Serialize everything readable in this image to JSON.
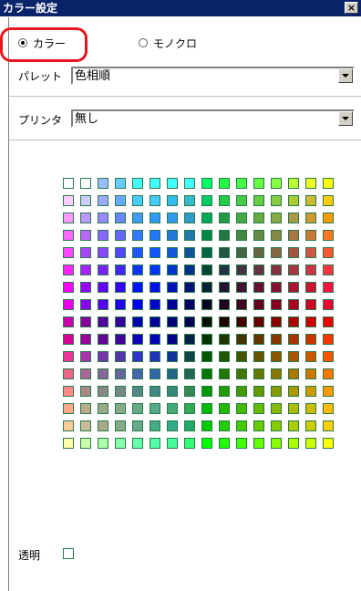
{
  "window": {
    "title": "カラー設定",
    "close_label": "×"
  },
  "mode": {
    "options": [
      "カラー",
      "モノクロ"
    ],
    "selected": "カラー"
  },
  "palette": {
    "label": "パレット",
    "value": "色相順"
  },
  "printer": {
    "label": "プリンタ",
    "value": "無し"
  },
  "transparent": {
    "label": "透明"
  },
  "colors": {
    "title_bar": "#0a246a",
    "highlight": "#e8141e",
    "swatch_border": "#2a7a4a"
  },
  "swatches": [
    [
      "#ffffff",
      "#ffffff",
      "#99bbff",
      "#66ccff",
      "#44ffff",
      "#44ffff",
      "#44ffff",
      "#44ffff",
      "#00ff66",
      "#22ff44",
      "#44ff44",
      "#66ff44",
      "#88ff44",
      "#bbff33",
      "#eeff22",
      "#ffff00"
    ],
    [
      "#ffccff",
      "#ccccff",
      "#99aaff",
      "#66aaff",
      "#44ccff",
      "#44ccff",
      "#33bbee",
      "#33bbcc",
      "#00cc66",
      "#22cc44",
      "#44cc44",
      "#66cc44",
      "#88cc44",
      "#aacc33",
      "#ccbb33",
      "#ffcc00"
    ],
    [
      "#ff99ff",
      "#bb99ff",
      "#9988ff",
      "#6688ff",
      "#4499ff",
      "#3399ff",
      "#3399ee",
      "#3399cc",
      "#00aa55",
      "#229944",
      "#44aa44",
      "#66aa44",
      "#88aa44",
      "#aa9944",
      "#cc9933",
      "#ff9900"
    ],
    [
      "#ff66ff",
      "#bb66ff",
      "#8866ff",
      "#6666ff",
      "#3377ff",
      "#2277ff",
      "#2277dd",
      "#2277aa",
      "#008844",
      "#227744",
      "#448844",
      "#668844",
      "#888844",
      "#aa7744",
      "#cc7733",
      "#ff7722"
    ],
    [
      "#ff44ff",
      "#aa44ff",
      "#8844ff",
      "#5544ff",
      "#2255ff",
      "#1155ff",
      "#1155dd",
      "#115599",
      "#006644",
      "#225544",
      "#446644",
      "#666644",
      "#886644",
      "#aa5544",
      "#cc5544",
      "#ff5533"
    ],
    [
      "#ff22ff",
      "#aa22ff",
      "#7722ff",
      "#4422ff",
      "#1133ff",
      "#0033ff",
      "#0033cc",
      "#003388",
      "#004433",
      "#223344",
      "#443344",
      "#663344",
      "#883344",
      "#aa3344",
      "#cc3344",
      "#ff3344"
    ],
    [
      "#ff00ff",
      "#9900ff",
      "#6600ff",
      "#3300ff",
      "#0011ff",
      "#0011ee",
      "#0011bb",
      "#001177",
      "#002233",
      "#221133",
      "#441133",
      "#661133",
      "#881133",
      "#aa1133",
      "#cc1133",
      "#ff1144"
    ],
    [
      "#ee00ee",
      "#8800ee",
      "#5500ee",
      "#2200ee",
      "#0000ee",
      "#0000cc",
      "#000099",
      "#000066",
      "#000022",
      "#220022",
      "#440022",
      "#660022",
      "#880022",
      "#aa0022",
      "#cc0022",
      "#ee0033"
    ],
    [
      "#cc00aa",
      "#880099",
      "#550099",
      "#330099",
      "#0000aa",
      "#000099",
      "#000077",
      "#000055",
      "#001100",
      "#220000",
      "#440000",
      "#660000",
      "#880000",
      "#aa0000",
      "#cc0000",
      "#ee0000"
    ],
    [
      "#dd0099",
      "#990099",
      "#660099",
      "#440099",
      "#1100bb",
      "#0000bb",
      "#000088",
      "#002244",
      "#003300",
      "#223300",
      "#443300",
      "#663300",
      "#883300",
      "#aa3300",
      "#cc3300",
      "#ff3300"
    ],
    [
      "#ee3399",
      "#aa33aa",
      "#7733aa",
      "#5533aa",
      "#3333cc",
      "#2233bb",
      "#113399",
      "#114444",
      "#005500",
      "#225500",
      "#445500",
      "#665500",
      "#885500",
      "#aa5500",
      "#cc5500",
      "#ff5500"
    ],
    [
      "#ee6688",
      "#aa6699",
      "#886699",
      "#666699",
      "#4466aa",
      "#3366aa",
      "#226688",
      "#226655",
      "#007700",
      "#227700",
      "#447700",
      "#667700",
      "#887700",
      "#aa7700",
      "#cc7700",
      "#ff7700"
    ],
    [
      "#ff8888",
      "#aa8888",
      "#888888",
      "#778888",
      "#558888",
      "#448888",
      "#338877",
      "#338855",
      "#009900",
      "#229900",
      "#449900",
      "#669900",
      "#889900",
      "#aa9900",
      "#cc9900",
      "#ff9900"
    ],
    [
      "#ffaa88",
      "#bbaa88",
      "#99aa88",
      "#88aa88",
      "#66aa88",
      "#55aa88",
      "#44aa77",
      "#33aa55",
      "#00bb00",
      "#22bb00",
      "#44bb00",
      "#66bb00",
      "#88bb00",
      "#aabb00",
      "#ccbb00",
      "#ffbb00"
    ],
    [
      "#ffcc99",
      "#ccbb99",
      "#aaaa88",
      "#88aa88",
      "#66aa88",
      "#44aa88",
      "#33aa88",
      "#22aa66",
      "#00cc00",
      "#22cc00",
      "#44cc00",
      "#66cc00",
      "#88cc00",
      "#aacc00",
      "#cccc00",
      "#ffcc00"
    ],
    [
      "#ffffaa",
      "#ccffaa",
      "#aaffaa",
      "#88ffaa",
      "#66ffaa",
      "#55ffaa",
      "#44ff99",
      "#33ff77",
      "#00ff00",
      "#22ff00",
      "#44ff00",
      "#66ff00",
      "#88ff00",
      "#aaff00",
      "#ccff00",
      "#ffff00"
    ]
  ]
}
